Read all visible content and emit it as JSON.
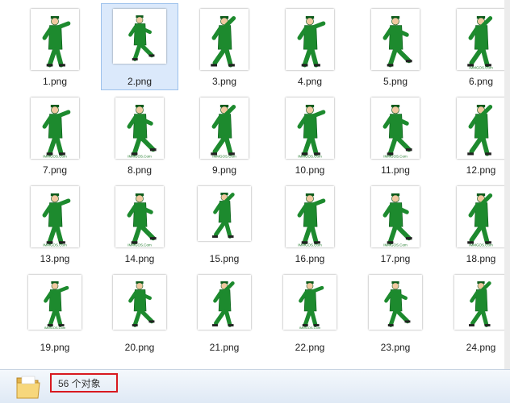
{
  "files": [
    {
      "name": "1.png",
      "tall": true,
      "caption": false
    },
    {
      "name": "2.png",
      "tall": false,
      "caption": false
    },
    {
      "name": "3.png",
      "tall": true,
      "caption": false
    },
    {
      "name": "4.png",
      "tall": true,
      "caption": false
    },
    {
      "name": "5.png",
      "tall": true,
      "caption": false
    },
    {
      "name": "6.png",
      "tall": true,
      "caption": true
    },
    {
      "name": "7.png",
      "tall": true,
      "caption": true
    },
    {
      "name": "8.png",
      "tall": true,
      "caption": true
    },
    {
      "name": "9.png",
      "tall": true,
      "caption": true
    },
    {
      "name": "10.png",
      "tall": true,
      "caption": true
    },
    {
      "name": "11.png",
      "tall": true,
      "caption": true
    },
    {
      "name": "12.png",
      "tall": true,
      "caption": false
    },
    {
      "name": "13.png",
      "tall": true,
      "caption": true
    },
    {
      "name": "14.png",
      "tall": true,
      "caption": true
    },
    {
      "name": "15.png",
      "tall": false,
      "caption": false
    },
    {
      "name": "16.png",
      "tall": true,
      "caption": true
    },
    {
      "name": "17.png",
      "tall": true,
      "caption": true
    },
    {
      "name": "18.png",
      "tall": true,
      "caption": true
    },
    {
      "name": "19.png",
      "tall": false,
      "caption": true
    },
    {
      "name": "20.png",
      "tall": false,
      "caption": false
    },
    {
      "name": "21.png",
      "tall": false,
      "caption": false
    },
    {
      "name": "22.png",
      "tall": false,
      "caption": true
    },
    {
      "name": "23.png",
      "tall": false,
      "caption": false
    },
    {
      "name": "24.png",
      "tall": false,
      "caption": false
    }
  ],
  "selected_file": "2.png",
  "thumb_caption": "IMMGOS.Com",
  "status": {
    "count_text": "56 个对象"
  },
  "colors": {
    "uniform": "#1d8a2e",
    "uniform_dark": "#0c5a1a",
    "caption": "#1e7a2a",
    "selection": "#dbe9fb",
    "highlight_box": "#d8191f"
  }
}
